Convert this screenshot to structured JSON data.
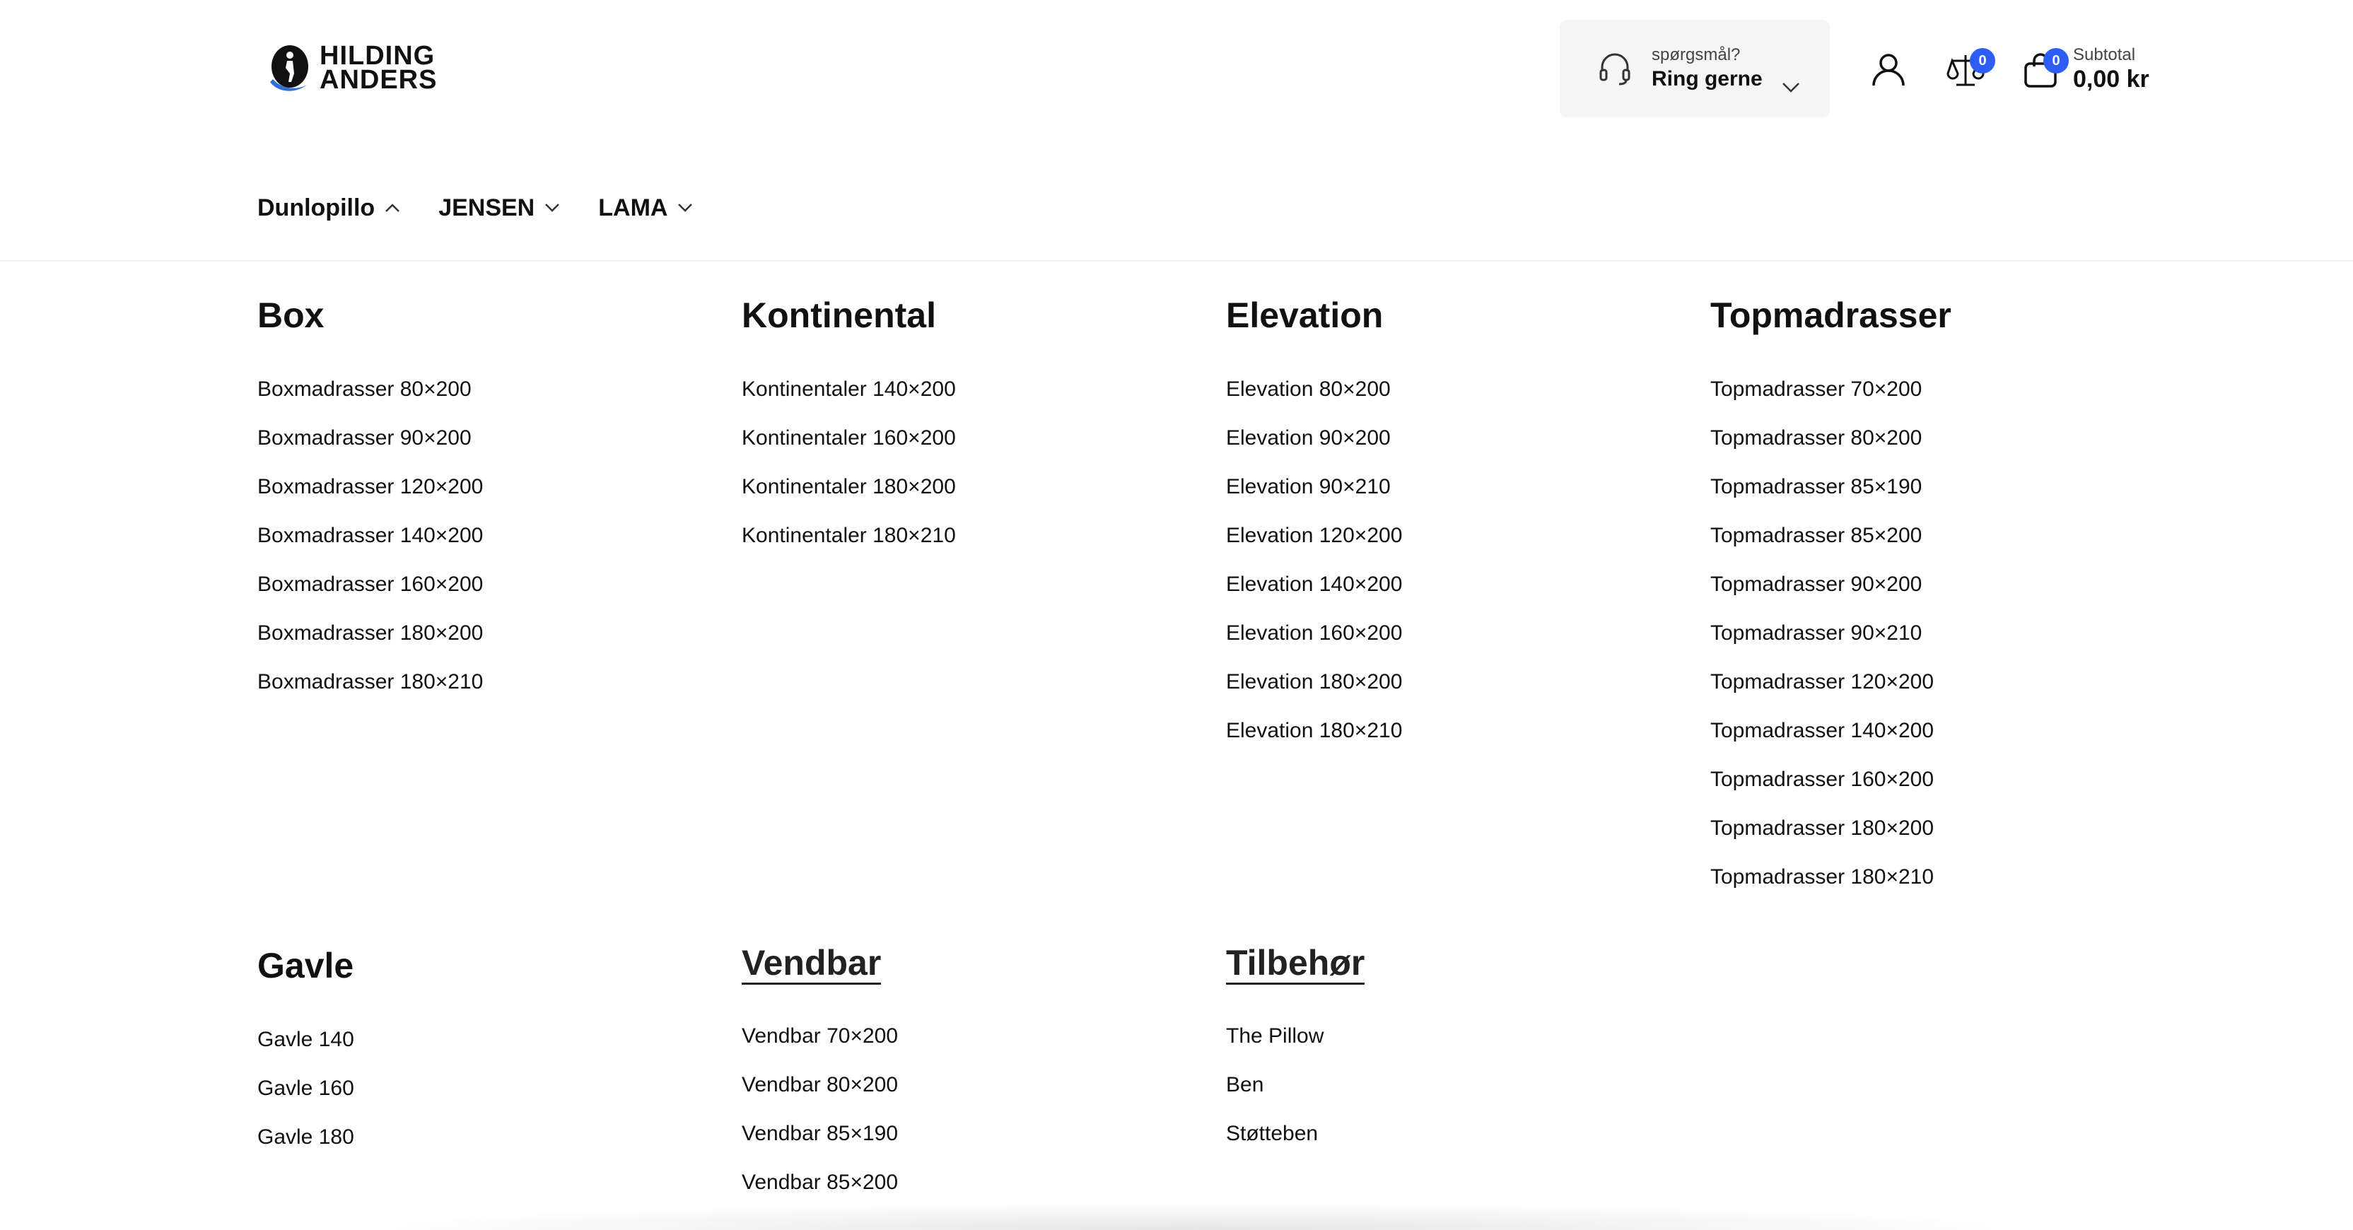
{
  "header": {
    "logo": {
      "line1": "HILDING",
      "line2": "ANDERS",
      "icon": "hilding-anders-logo-icon"
    },
    "support": {
      "small_label": "spørgsmål?",
      "big_label": "Ring gerne",
      "icon": "headset-icon",
      "chevron": "chevron-down-icon"
    },
    "account_icon": "user-icon",
    "compare": {
      "icon": "scale-icon",
      "count": "0"
    },
    "cart": {
      "icon": "shopping-bag-icon",
      "count": "0",
      "subtotal_label": "Subtotal",
      "subtotal_value": "0,00 kr"
    },
    "badge_color": "#2d5cf6"
  },
  "nav": {
    "items": [
      {
        "label": "Dunlopillo",
        "state": "open",
        "icon": "chevron-up-icon"
      },
      {
        "label": "JENSEN",
        "state": "closed",
        "icon": "chevron-down-icon"
      },
      {
        "label": "LAMA",
        "state": "closed",
        "icon": "chevron-down-icon"
      }
    ]
  },
  "mega_menu": {
    "columns": [
      {
        "heading": "Box",
        "items": [
          "Boxmadrasser 80×200",
          "Boxmadrasser 90×200",
          "Boxmadrasser 120×200",
          "Boxmadrasser 140×200",
          "Boxmadrasser 160×200",
          "Boxmadrasser 180×200",
          "Boxmadrasser 180×210"
        ]
      },
      {
        "heading": "Kontinental",
        "items": [
          "Kontinentaler 140×200",
          "Kontinentaler 160×200",
          "Kontinentaler 180×200",
          "Kontinentaler 180×210"
        ]
      },
      {
        "heading": "Elevation",
        "items": [
          "Elevation 80×200",
          "Elevation 90×200",
          "Elevation 90×210",
          "Elevation 120×200",
          "Elevation 140×200",
          "Elevation 160×200",
          "Elevation 180×200",
          "Elevation 180×210"
        ]
      },
      {
        "heading": "Topmadrasser",
        "items": [
          "Topmadrasser 70×200",
          "Topmadrasser 80×200",
          "Topmadrasser 85×190",
          "Topmadrasser 85×200",
          "Topmadrasser 90×200",
          "Topmadrasser 90×210",
          "Topmadrasser 120×200",
          "Topmadrasser 140×200",
          "Topmadrasser 160×200",
          "Topmadrasser 180×200",
          "Topmadrasser 180×210"
        ]
      },
      {
        "heading": "Gavle",
        "items": [
          "Gavle 140",
          "Gavle 160",
          "Gavle 180"
        ]
      },
      {
        "heading": "Vendbar",
        "items": [
          "Vendbar 70×200",
          "Vendbar 80×200",
          "Vendbar 85×190",
          "Vendbar 85×200"
        ]
      },
      {
        "heading": "Tilbehør",
        "items": [
          "The Pillow",
          "Ben",
          "Støtteben"
        ]
      }
    ]
  }
}
